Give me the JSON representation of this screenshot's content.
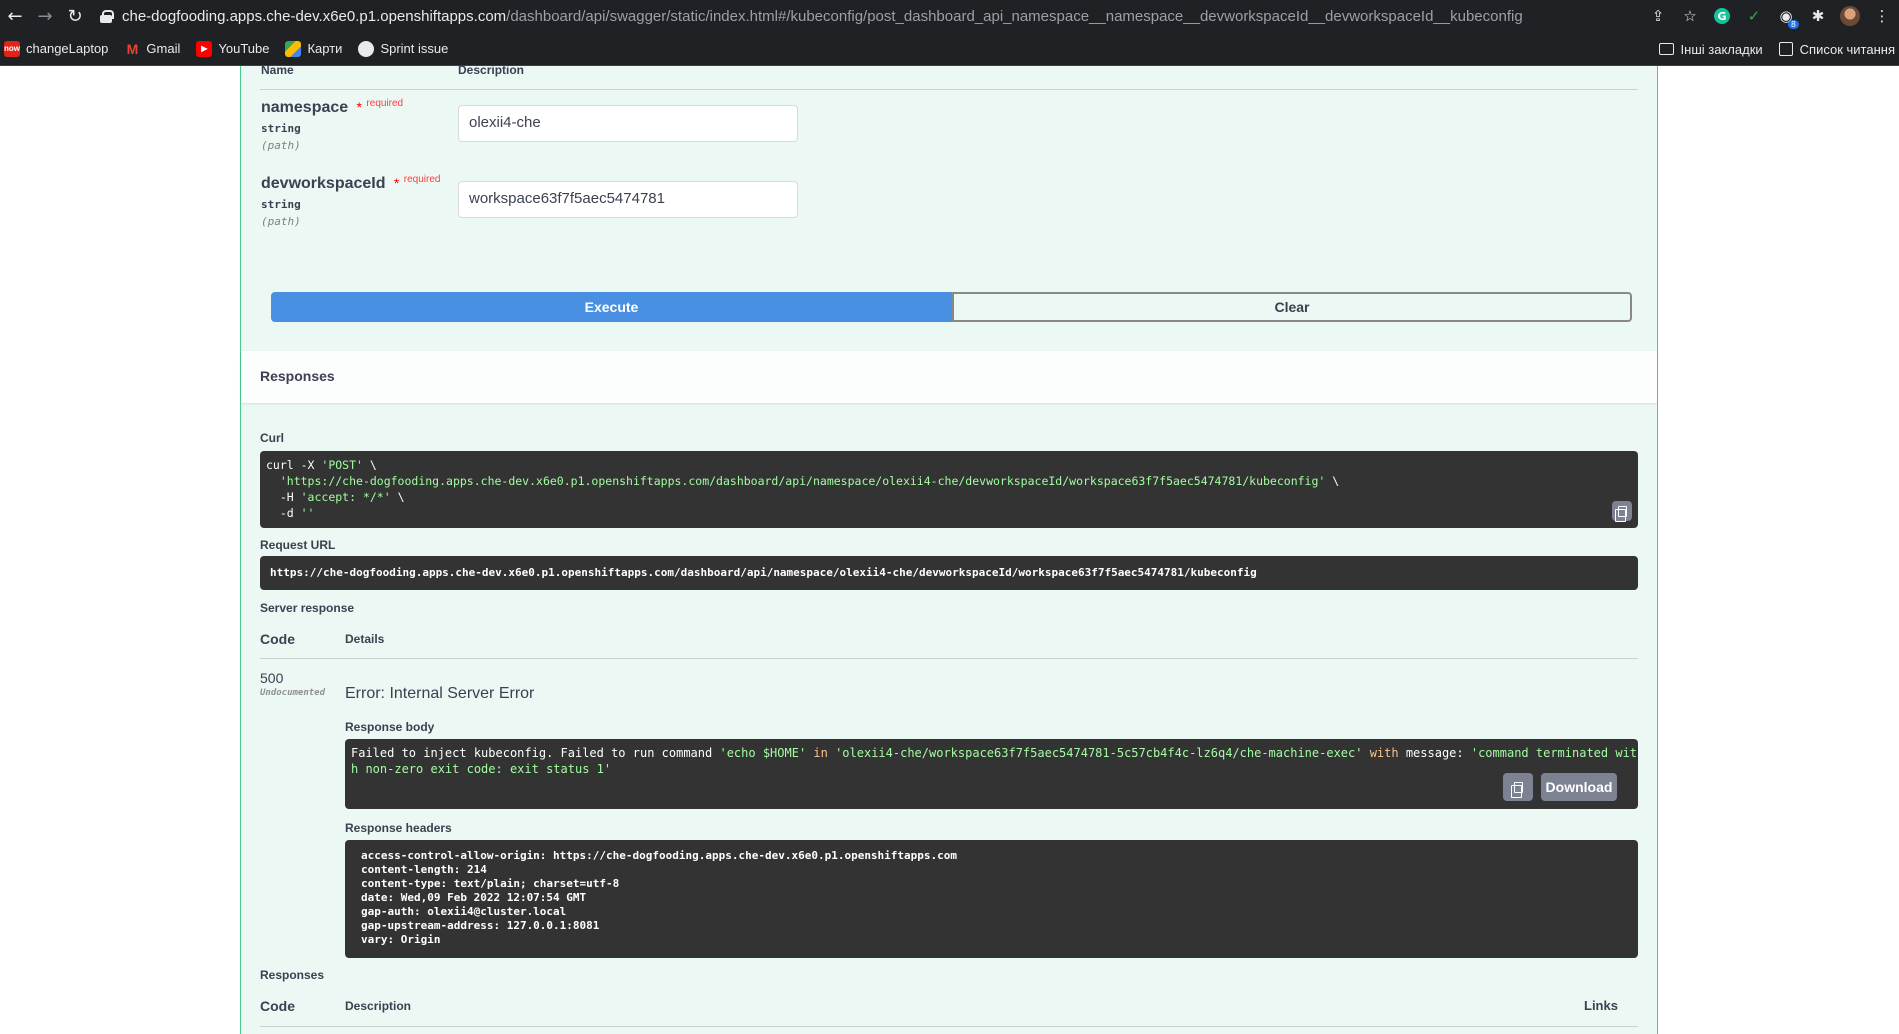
{
  "browser": {
    "url_host": "che-dogfooding.apps.che-dev.x6e0.p1.openshiftapps.com",
    "url_path": "/dashboard/api/swagger/static/index.html#/kubeconfig/post_dashboard_api_namespace__namespace__devworkspaceId__devworkspaceId__kubeconfig",
    "extension_badge": "8",
    "grammarly_letter": "G"
  },
  "bookmarks": {
    "items": [
      {
        "label": "changeLaptop",
        "favicon": "now",
        "color": "#e2231a"
      },
      {
        "label": "Gmail",
        "favicon": "M",
        "color": "#ea4335"
      },
      {
        "label": "YouTube",
        "favicon": "▶",
        "color": "#ff0000"
      },
      {
        "label": "Карти",
        "favicon": "map",
        "color": "#34a853"
      },
      {
        "label": "Sprint issue",
        "favicon": "github",
        "color": "#e8eaed"
      }
    ],
    "other_label": "Інші закладки",
    "reading_list_label": "Список читання"
  },
  "params": {
    "col_name": "Name",
    "col_description": "Description",
    "required_label": "required",
    "items": [
      {
        "name": "namespace",
        "type": "string",
        "in": "(path)",
        "value": "olexii4-che"
      },
      {
        "name": "devworkspaceId",
        "type": "string",
        "in": "(path)",
        "value": "workspace63f7f5aec5474781"
      }
    ]
  },
  "buttons": {
    "execute": "Execute",
    "clear": "Clear"
  },
  "responses": {
    "title": "Responses",
    "curl_label": "Curl",
    "curl_lines": {
      "l1_a": "curl -X ",
      "l1_b": "'POST'",
      "l1_c": " \\",
      "l2_a": "  ",
      "l2_b": "'https://che-dogfooding.apps.che-dev.x6e0.p1.openshiftapps.com/dashboard/api/namespace/olexii4-che/devworkspaceId/workspace63f7f5aec5474781/kubeconfig'",
      "l2_c": " \\",
      "l3_a": "  -H ",
      "l3_b": "'accept: */*'",
      "l3_c": " \\",
      "l4_a": "  -d ",
      "l4_b": "''"
    },
    "request_url_label": "Request URL",
    "request_url": "https://che-dogfooding.apps.che-dev.x6e0.p1.openshiftapps.com/dashboard/api/namespace/olexii4-che/devworkspaceId/workspace63f7f5aec5474781/kubeconfig",
    "server_response_label": "Server response",
    "col_code": "Code",
    "col_details": "Details",
    "code": "500",
    "undocumented": "Undocumented",
    "error_title": "Error: Internal Server Error",
    "response_body_label": "Response body",
    "body": {
      "p1": "Failed to inject kubeconfig. Failed to run command ",
      "p2": "'echo $HOME'",
      "p3": " in ",
      "p4": "'olexii4-che/workspace63f7f5aec5474781-5c57cb4f4c-lz6q4/che-machine-exec'",
      "p5": " with",
      "p6": " message: ",
      "p7": "'command terminated wit",
      "p8": "h non-zero exit code: exit status 1'"
    },
    "download_label": "Download",
    "response_headers_label": "Response headers",
    "headers": [
      "access-control-allow-origin: https://che-dogfooding.apps.che-dev.x6e0.p1.openshiftapps.com",
      "content-length: 214",
      "content-type: text/plain; charset=utf-8",
      "date: Wed,09 Feb 2022 12:07:54 GMT",
      "gap-auth: olexii4@cluster.local",
      "gap-upstream-address: 127.0.0.1:8081",
      "vary: Origin"
    ],
    "responses_label": "Responses",
    "bottom_col_code": "Code",
    "bottom_col_description": "Description",
    "bottom_col_links": "Links"
  }
}
